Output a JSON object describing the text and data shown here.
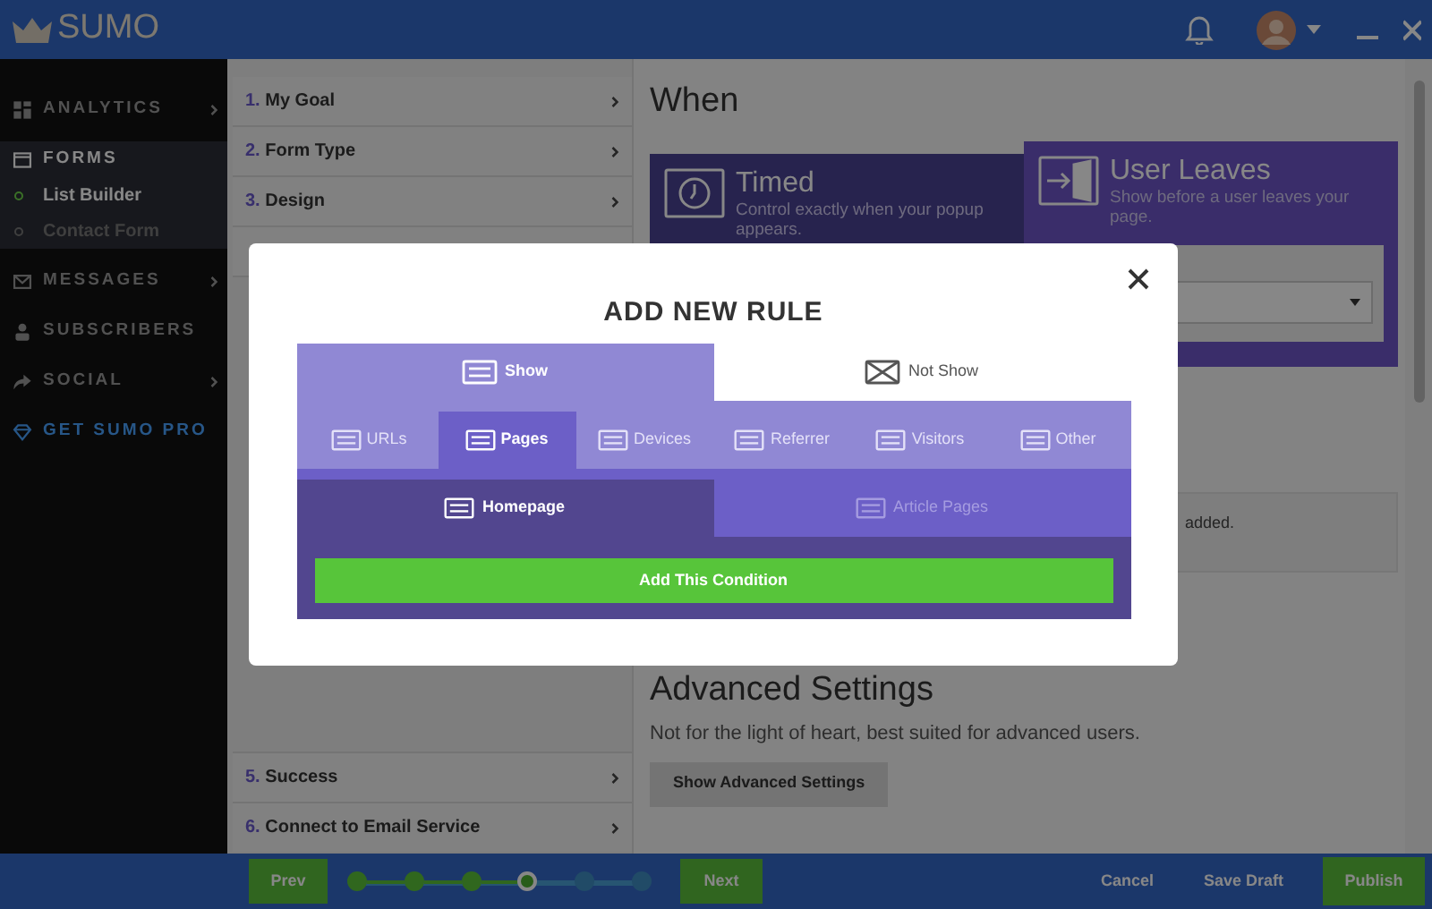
{
  "header": {
    "logo": "SUMO"
  },
  "sidebar": {
    "items": [
      {
        "label": "ANALYTICS",
        "chevron": true,
        "expanded": false
      },
      {
        "label": "FORMS",
        "chevron": false,
        "expanded": true,
        "children": [
          {
            "label": "List Builder",
            "selected": true
          },
          {
            "label": "Contact Form",
            "selected": false
          }
        ]
      },
      {
        "label": "MESSAGES",
        "chevron": true,
        "expanded": false
      },
      {
        "label": "SUBSCRIBERS",
        "chevron": false,
        "expanded": false
      },
      {
        "label": "SOCIAL",
        "chevron": true,
        "expanded": false
      },
      {
        "label": "GET SUMO PRO",
        "chevron": false,
        "expanded": false,
        "kind": "promo"
      }
    ]
  },
  "steps_top": [
    {
      "number": "1.",
      "label": "My Goal"
    },
    {
      "number": "2.",
      "label": "Form Type"
    },
    {
      "number": "3.",
      "label": "Design"
    }
  ],
  "steps_bottom": [
    {
      "number": "5.",
      "label": "Success"
    },
    {
      "number": "6.",
      "label": "Connect to Email Service"
    }
  ],
  "main": {
    "heading": "When",
    "cards": [
      {
        "title": "Timed",
        "description": "Control exactly when your popup appears.",
        "selected": false
      },
      {
        "title": "User Leaves",
        "description": "Show before a user leaves your page.",
        "selected": true
      }
    ],
    "rules_note": "added.",
    "advanced": {
      "heading": "Advanced Settings",
      "description": "Not for the light of heart, best suited for advanced users.",
      "button": "Show Advanced Settings"
    }
  },
  "footer": {
    "prev": "Prev",
    "next": "Next",
    "progress": [
      {
        "kind": "done"
      },
      {
        "kind": "done"
      },
      {
        "kind": "done"
      },
      {
        "kind": "current"
      },
      {
        "kind": "todo"
      },
      {
        "kind": "todo"
      }
    ],
    "cancel": "Cancel",
    "save": "Save Draft",
    "publish": "Publish"
  },
  "modal": {
    "title": "ADD NEW RULE",
    "mode_tabs": [
      {
        "label": "Show",
        "selected": true
      },
      {
        "label": "Not Show",
        "selected": false
      }
    ],
    "category_tabs": [
      {
        "label": "URLs",
        "selected": false
      },
      {
        "label": "Pages",
        "selected": true
      },
      {
        "label": "Devices",
        "selected": false
      },
      {
        "label": "Referrer",
        "selected": false
      },
      {
        "label": "Visitors",
        "selected": false
      },
      {
        "label": "Other",
        "selected": false
      }
    ],
    "page_tabs": [
      {
        "label": "Homepage",
        "selected": true
      },
      {
        "label": "Article Pages",
        "selected": false
      }
    ],
    "add_button": "Add This Condition"
  }
}
